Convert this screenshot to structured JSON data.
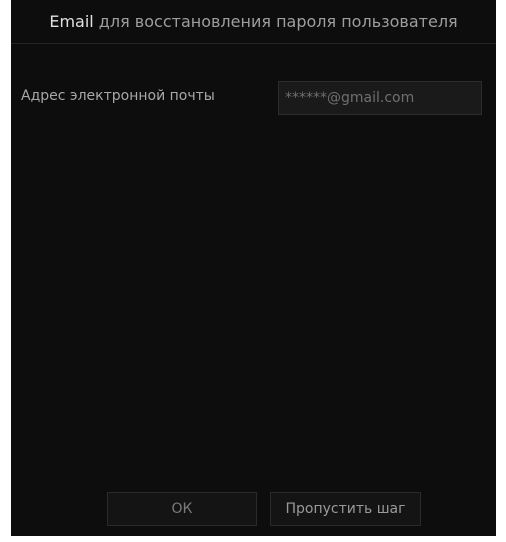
{
  "dialog": {
    "title_prefix": "Email",
    "title_rest": " для восстановления пароля пользователя"
  },
  "form": {
    "email_label": "Адрес электронной почты",
    "email_value": "******@gmail.com"
  },
  "buttons": {
    "ok_label": "ОК",
    "skip_label": "Пропустить шаг"
  },
  "colors": {
    "background": "#0d0d0d",
    "input_background": "#1a1a1a",
    "text": "#a8a8a8"
  }
}
